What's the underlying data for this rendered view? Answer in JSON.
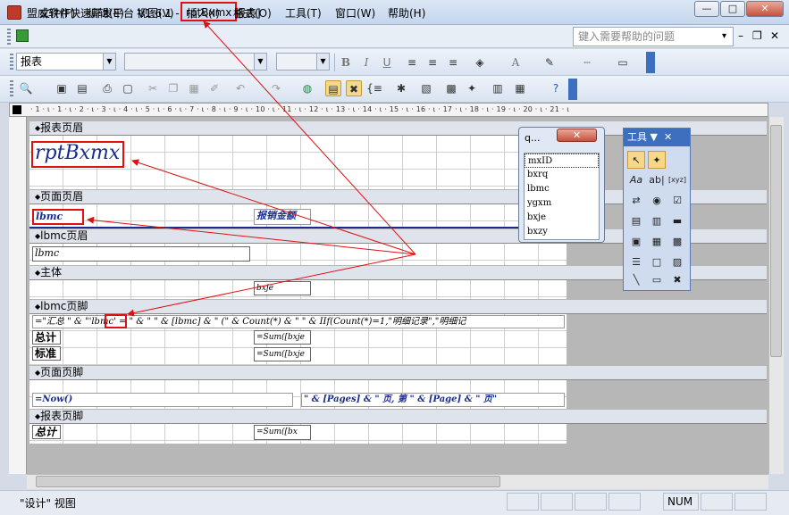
{
  "title": {
    "pre": "盟威软件快速开发平台 V1.6.1 - ",
    "name": "rptBxmx",
    "post": "报表]"
  },
  "window_buttons": {
    "minimize": "—",
    "restore": "□",
    "close": "✕"
  },
  "menu": [
    "文件(F)",
    "编辑(E)",
    "视图(V)",
    "插入(I)",
    "格式(O)",
    "工具(T)",
    "窗口(W)",
    "帮助(H)"
  ],
  "help_placeholder": "键入需要帮助的问题",
  "mdi_buttons": [
    "▾",
    "–",
    "❐",
    "✕"
  ],
  "format_bar": {
    "object_combo": "报表",
    "bold": "B",
    "italic": "I",
    "underline": "U",
    "font_color": "A"
  },
  "ruler_text": "· 1 · ι · 1 · ι · 2 · ι · 3 · ι · 4 · ι · 5 · ι · 6 · ι · 7 · ι · 8 · ι · 9 · ι · 10 · ι · 11 · ι · 12 · ι · 13 · ι · 14 · ι · 15 · ι · 16 · ι · 17 · ι · 18 · ι · 19 · ι · 20 · ι · 21 · ι",
  "bands": {
    "report_header": "报表页眉",
    "page_header": "页面页眉",
    "lbmc_header": "lbmc页眉",
    "detail": "主体",
    "lbmc_footer": "lbmc页脚",
    "page_footer": "页面页脚",
    "report_footer": "报表页脚"
  },
  "controls": {
    "report_title": "rptBxmx",
    "lbmc_label": "lbmc",
    "amount_label": "报销金额",
    "lbmc_text": "lbmc",
    "bxje": "bxje",
    "summary_expr": "=\"汇总 \" & \"'lbmc' = \" & \" \" & [lbmc] & \" (\" & Count(*) & \" \" & IIf(Count(*)=1,\"明细记录\",\"明细记",
    "summary_lbmc_highlight": "lbmc",
    "total_label": "总计",
    "total_sum": "=Sum([bxje",
    "standard_label": "标准",
    "standard_sum": "=Sum([bxje",
    "now_expr": "=Now()",
    "pages_expr": "\" & [Pages] & \" 页, 第 \" & [Page] & \" 页\"",
    "grand_total_label": "总计",
    "grand_total_sum": "=Sum([bx"
  },
  "field_list": {
    "title": "q...",
    "close": "✕",
    "items": [
      "mxID",
      "bxrq",
      "lbmc",
      "ygxm",
      "bxje",
      "bxzy"
    ]
  },
  "toolbox": {
    "title": "工具",
    "tools": [
      "↖",
      "✦",
      "Aa",
      "ab|",
      "[xyz]",
      "⇄",
      "◉",
      "☑",
      "▤",
      "▥",
      "▬",
      "▣",
      "▦",
      "▩",
      "☰",
      "□",
      "▨",
      "╲",
      "▭",
      "✖"
    ]
  },
  "status": {
    "view": "\"设计\" 视图",
    "num": "NUM"
  },
  "colors": {
    "accent": "#e01010",
    "titlebar": "#c4d6ee",
    "toolbox_head": "#3d6fc0"
  }
}
